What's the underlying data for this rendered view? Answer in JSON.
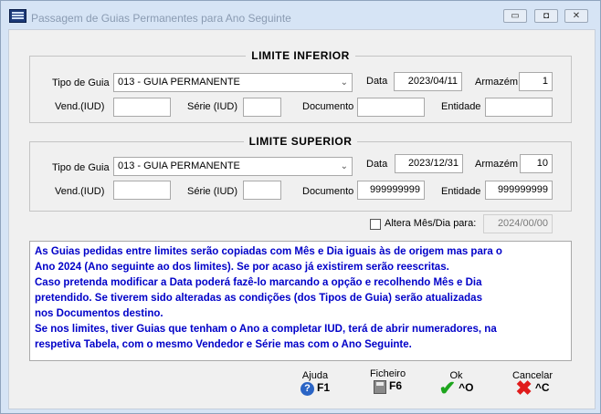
{
  "window": {
    "title": "Passagem de Guias Permanentes para Ano Seguinte",
    "controls": {
      "minimize": "▭",
      "maximize": "◘",
      "close": "✕"
    }
  },
  "limite_inferior": {
    "title": "LIMITE INFERIOR",
    "tipo_guia_label": "Tipo de Guia",
    "tipo_guia_value": "013 - GUIA PERMANENTE",
    "data_label": "Data",
    "data_value": "2023/04/11",
    "armazem_label": "Armazém",
    "armazem_value": "1",
    "vend_label": "Vend.(IUD)",
    "vend_value": "",
    "serie_label": "Série (IUD)",
    "serie_value": "",
    "documento_label": "Documento",
    "documento_value": "",
    "entidade_label": "Entidade",
    "entidade_value": ""
  },
  "limite_superior": {
    "title": "LIMITE SUPERIOR",
    "tipo_guia_label": "Tipo de Guia",
    "tipo_guia_value": "013 - GUIA PERMANENTE",
    "data_label": "Data",
    "data_value": "2023/12/31",
    "armazem_label": "Armazém",
    "armazem_value": "10",
    "vend_label": "Vend.(IUD)",
    "vend_value": "",
    "serie_label": "Série (IUD)",
    "serie_value": "",
    "documento_label": "Documento",
    "documento_value": "999999999",
    "entidade_label": "Entidade",
    "entidade_value": "999999999"
  },
  "altera": {
    "label": "Altera Mês/Dia para:",
    "checked": false,
    "value": "2024/00/00"
  },
  "info_lines": [
    "As Guias pedidas entre limites serão copiadas com Mês e Dia iguais às de origem mas para o",
    "Ano 2024 (Ano seguinte ao dos limites). Se por acaso já existirem serão reescritas.",
    "Caso pretenda modificar a Data poderá fazê-lo marcando a opção e recolhendo Mês e Dia",
    "pretendido. Se tiverem sido alteradas as condições (dos Tipos de Guia) serão atualizadas",
    "nos Documentos destino.",
    "Se nos limites,  tiver Guias que tenham o Ano a completar IUD, terá de abrir numeradores, na",
    "respetiva Tabela, com o mesmo Vendedor e Série mas com o Ano Seguinte."
  ],
  "toolbar": {
    "ajuda_label": "Ajuda",
    "ajuda_key": "F1",
    "ajuda_icon": "?",
    "ficheiro_label": "Ficheiro",
    "ficheiro_key": "F6",
    "ok_label": "Ok",
    "ok_key": "^O",
    "ok_icon": "✔",
    "cancelar_label": "Cancelar",
    "cancelar_key": "^C",
    "cancelar_icon": "✖"
  },
  "colors": {
    "title_bar": "#d6e4f5",
    "info_text": "#0000c8",
    "ok_green": "#1da51d",
    "cancel_red": "#e01b1b"
  }
}
